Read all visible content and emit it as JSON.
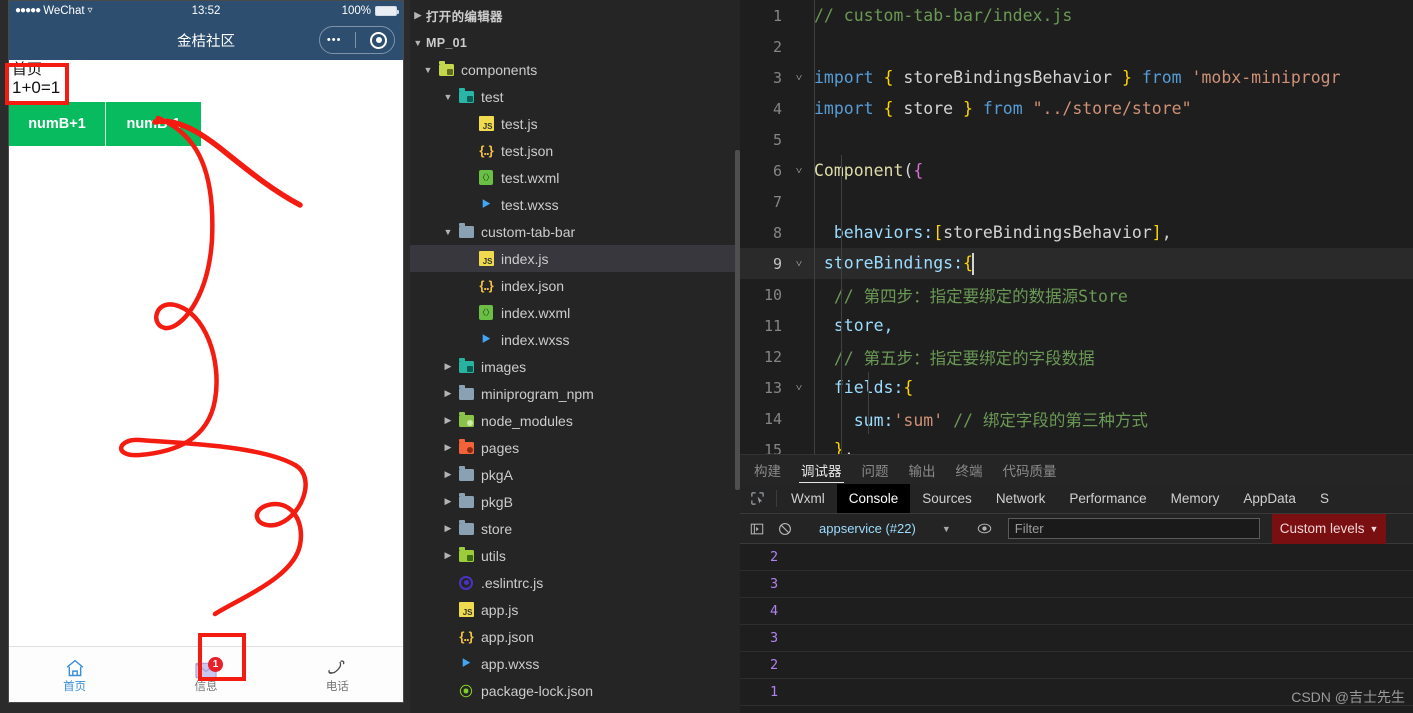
{
  "simulator": {
    "status_bar": {
      "carrier": "WeChat",
      "dots": "●●●●●",
      "wifi": "▾",
      "time": "13:52",
      "battery_pct": "100%"
    },
    "nav_bar": {
      "title": "金桔社区",
      "capsule_dots": "•••"
    },
    "page": {
      "title": "首页",
      "sum_expression": "1+0=1",
      "buttons": [
        {
          "label": "numB+1",
          "name": "numb-plus-button"
        },
        {
          "label": "numB-1",
          "name": "numb-minus-button"
        }
      ]
    },
    "tabbar": [
      {
        "label": "首页",
        "icon": "home-icon",
        "active": true,
        "badge": ""
      },
      {
        "label": "信息",
        "icon": "message-icon",
        "active": false,
        "badge": "1"
      },
      {
        "label": "电话",
        "icon": "phone-icon",
        "active": false,
        "badge": ""
      }
    ]
  },
  "explorer": {
    "open_editors_label": "打开的编辑器",
    "project_label": "MP_01",
    "items": [
      {
        "label": "components",
        "type": "folder",
        "icon": "folder-components-icon",
        "depth": 1,
        "open": true,
        "color": "#c4d64c"
      },
      {
        "label": "test",
        "type": "folder",
        "icon": "folder-test-icon",
        "depth": 2,
        "open": true,
        "color": "#29b6a8"
      },
      {
        "label": "test.js",
        "type": "js",
        "icon": "js-file-icon",
        "depth": 3
      },
      {
        "label": "test.json",
        "type": "json",
        "icon": "json-file-icon",
        "depth": 3
      },
      {
        "label": "test.wxml",
        "type": "wxml",
        "icon": "wxml-file-icon",
        "depth": 3
      },
      {
        "label": "test.wxss",
        "type": "wxss",
        "icon": "wxss-file-icon",
        "depth": 3
      },
      {
        "label": "custom-tab-bar",
        "type": "folder",
        "icon": "folder-icon",
        "depth": 2,
        "open": true,
        "color": "#8aa1b4"
      },
      {
        "label": "index.js",
        "type": "js",
        "icon": "js-file-icon",
        "depth": 3,
        "selected": true
      },
      {
        "label": "index.json",
        "type": "json",
        "icon": "json-file-icon",
        "depth": 3
      },
      {
        "label": "index.wxml",
        "type": "wxml",
        "icon": "wxml-file-icon",
        "depth": 3
      },
      {
        "label": "index.wxss",
        "type": "wxss",
        "icon": "wxss-file-icon",
        "depth": 3
      },
      {
        "label": "images",
        "type": "folder",
        "icon": "folder-images-icon",
        "depth": 2,
        "open": false,
        "color": "#27b3a0"
      },
      {
        "label": "miniprogram_npm",
        "type": "folder",
        "icon": "folder-icon",
        "depth": 2,
        "open": false,
        "color": "#8aa1b4"
      },
      {
        "label": "node_modules",
        "type": "folder",
        "icon": "folder-node-icon",
        "depth": 2,
        "open": false,
        "color": "#8bc34a"
      },
      {
        "label": "pages",
        "type": "folder",
        "icon": "folder-pages-icon",
        "depth": 2,
        "open": false,
        "color": "#f4623a"
      },
      {
        "label": "pkgA",
        "type": "folder",
        "icon": "folder-icon",
        "depth": 2,
        "open": false,
        "color": "#8aa1b4"
      },
      {
        "label": "pkgB",
        "type": "folder",
        "icon": "folder-icon",
        "depth": 2,
        "open": false,
        "color": "#8aa1b4"
      },
      {
        "label": "store",
        "type": "folder",
        "icon": "folder-icon",
        "depth": 2,
        "open": false,
        "color": "#8aa1b4"
      },
      {
        "label": "utils",
        "type": "folder",
        "icon": "folder-utils-icon",
        "depth": 2,
        "open": false,
        "color": "#9ccc3c"
      },
      {
        "label": ".eslintrc.js",
        "type": "eslint",
        "icon": "eslint-file-icon",
        "depth": 2
      },
      {
        "label": "app.js",
        "type": "js",
        "icon": "js-file-icon",
        "depth": 2
      },
      {
        "label": "app.json",
        "type": "json",
        "icon": "json-file-icon",
        "depth": 2
      },
      {
        "label": "app.wxss",
        "type": "wxss",
        "icon": "wxss-file-icon",
        "depth": 2
      },
      {
        "label": "package-lock.json",
        "type": "node",
        "icon": "nodejs-file-icon",
        "depth": 2
      }
    ]
  },
  "editor": {
    "lines": [
      {
        "num": "1",
        "fold": "",
        "cur": false,
        "indent": 0,
        "tokens": [
          {
            "t": "// custom-tab-bar/index.js",
            "c": "cmt"
          }
        ]
      },
      {
        "num": "2",
        "fold": "",
        "cur": false,
        "indent": 0,
        "tokens": []
      },
      {
        "num": "3",
        "fold": "v",
        "cur": false,
        "indent": 0,
        "tokens": [
          {
            "t": "import ",
            "c": "kw"
          },
          {
            "t": "{ ",
            "c": "brace"
          },
          {
            "t": "storeBindingsBehavior",
            "c": "plain"
          },
          {
            "t": " }",
            "c": "brace"
          },
          {
            "t": " from ",
            "c": "kw"
          },
          {
            "t": "'mobx-miniprogr",
            "c": "str"
          }
        ]
      },
      {
        "num": "4",
        "fold": "",
        "cur": false,
        "indent": 0,
        "tokens": [
          {
            "t": "import ",
            "c": "kw"
          },
          {
            "t": "{ ",
            "c": "brace"
          },
          {
            "t": "store",
            "c": "plain"
          },
          {
            "t": " }",
            "c": "brace"
          },
          {
            "t": " from ",
            "c": "kw"
          },
          {
            "t": "\"../store/store\"",
            "c": "str"
          }
        ]
      },
      {
        "num": "5",
        "fold": "",
        "cur": false,
        "indent": 0,
        "tokens": []
      },
      {
        "num": "6",
        "fold": "v",
        "cur": false,
        "indent": 0,
        "tokens": [
          {
            "t": "Component",
            "c": "orange"
          },
          {
            "t": "(",
            "c": "plain"
          },
          {
            "t": "{",
            "c": "brace2"
          }
        ]
      },
      {
        "num": "7",
        "fold": "",
        "cur": false,
        "indent": 1,
        "tokens": []
      },
      {
        "num": "8",
        "fold": "",
        "cur": false,
        "indent": 2,
        "tokens": [
          {
            "t": "  behaviors:",
            "c": "prop"
          },
          {
            "t": "[",
            "c": "brace"
          },
          {
            "t": "storeBindingsBehavior",
            "c": "plain"
          },
          {
            "t": "]",
            "c": "brace"
          },
          {
            "t": ",",
            "c": "plain"
          }
        ]
      },
      {
        "num": "9",
        "fold": "v",
        "cur": true,
        "indent": 1,
        "tokens": [
          {
            "t": " storeBindings:",
            "c": "prop"
          },
          {
            "t": "{",
            "c": "brace"
          }
        ]
      },
      {
        "num": "10",
        "fold": "",
        "cur": false,
        "indent": 2,
        "tokens": [
          {
            "t": "  // 第四步：指定要绑定的数据源Store",
            "c": "cmt"
          }
        ]
      },
      {
        "num": "11",
        "fold": "",
        "cur": false,
        "indent": 2,
        "tokens": [
          {
            "t": "  store,",
            "c": "prop"
          }
        ]
      },
      {
        "num": "12",
        "fold": "",
        "cur": false,
        "indent": 2,
        "tokens": [
          {
            "t": "  // 第五步：指定要绑定的字段数据",
            "c": "cmt"
          }
        ]
      },
      {
        "num": "13",
        "fold": "v",
        "cur": false,
        "indent": 2,
        "tokens": [
          {
            "t": "  fields:",
            "c": "prop"
          },
          {
            "t": "{",
            "c": "brace"
          }
        ]
      },
      {
        "num": "14",
        "fold": "",
        "cur": false,
        "indent": 3,
        "tokens": [
          {
            "t": "    sum:",
            "c": "prop"
          },
          {
            "t": "'sum'",
            "c": "str"
          },
          {
            "t": " // 绑定字段的第三种方式",
            "c": "cmt"
          }
        ]
      },
      {
        "num": "15",
        "fold": "",
        "cur": false,
        "indent": 2,
        "tokens": [
          {
            "t": "  }",
            "c": "brace"
          },
          {
            "t": ",",
            "c": "plain"
          }
        ]
      }
    ]
  },
  "devtools": {
    "panel_tabs": [
      {
        "label": "构建",
        "active": false
      },
      {
        "label": "调试器",
        "active": true
      },
      {
        "label": "问题",
        "active": false
      },
      {
        "label": "输出",
        "active": false
      },
      {
        "label": "终端",
        "active": false
      },
      {
        "label": "代码质量",
        "active": false
      }
    ],
    "dev_tabs": [
      {
        "label": "Wxml",
        "active": false
      },
      {
        "label": "Console",
        "active": true
      },
      {
        "label": "Sources",
        "active": false
      },
      {
        "label": "Network",
        "active": false
      },
      {
        "label": "Performance",
        "active": false
      },
      {
        "label": "Memory",
        "active": false
      },
      {
        "label": "AppData",
        "active": false
      },
      {
        "label": "S",
        "active": false
      }
    ],
    "toolbar": {
      "context": "appservice (#22)",
      "filter_placeholder": "Filter",
      "levels_label": "Custom levels",
      "levels_bg": "#7a0f12"
    },
    "console_lines": [
      "2",
      "3",
      "4",
      "3",
      "2",
      "1"
    ]
  },
  "watermark": "CSDN @吉士先生",
  "colors": {
    "wechat_header": "#2d4e6e",
    "button_green": "#09bb5f",
    "annotation_red": "#f41b10",
    "badge_red": "#e8202a",
    "active_tab_blue": "#3a8fd8"
  }
}
